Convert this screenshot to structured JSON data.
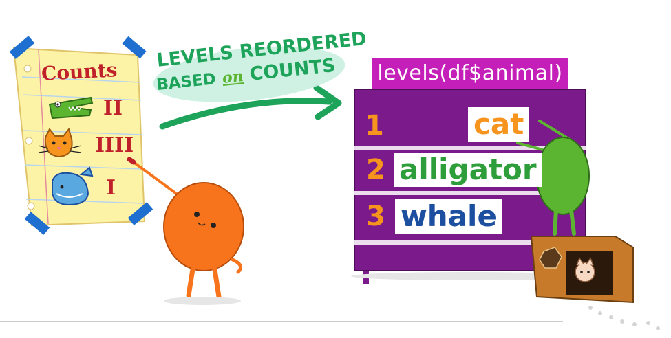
{
  "counts_sheet": {
    "title": "Counts",
    "rows": [
      {
        "animal_icon": "alligator-icon",
        "tally": "II"
      },
      {
        "animal_icon": "cat-icon",
        "tally": "IIII"
      },
      {
        "animal_icon": "whale-icon",
        "tally": "I"
      }
    ]
  },
  "arrow_caption": {
    "line1": "LEVELS REORDERED",
    "line2_a": "BASED",
    "line2_b": "on",
    "line2_c": "COUNTS"
  },
  "levels_board": {
    "title": "levels(df$animal)",
    "items": [
      {
        "rank": "1",
        "label": "cat",
        "color": "#f7941d"
      },
      {
        "rank": "2",
        "label": "alligator",
        "color": "#2e9e3a"
      },
      {
        "rank": "3",
        "label": "whale",
        "color": "#1c4fa0"
      }
    ]
  },
  "colors": {
    "board_purple": "#7b1a8a",
    "title_magenta": "#c41fb8",
    "arrow_green": "#1ea35a",
    "monster_orange": "#f7741d",
    "monster_green": "#5cb531",
    "paper_yellow": "#fdf3a6",
    "tape_blue": "#1e6fd0",
    "tally_red": "#c0202a"
  }
}
